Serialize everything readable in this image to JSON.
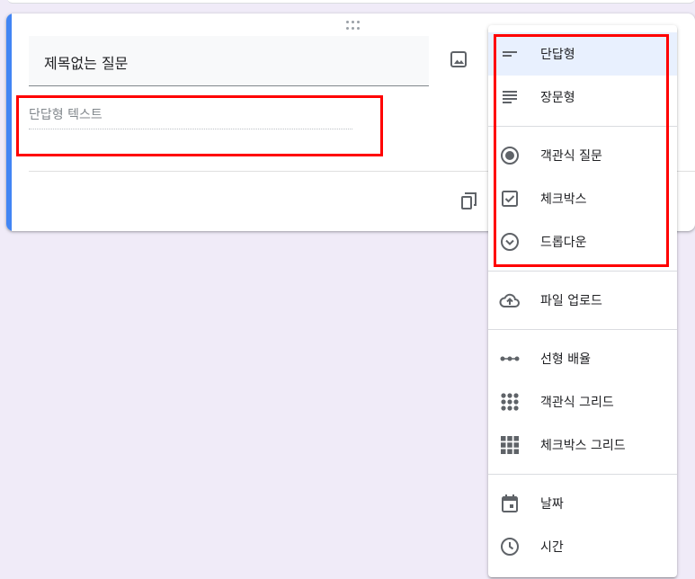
{
  "question": {
    "title": "제목없는 질문",
    "short_answer_placeholder": "단답형 텍스트"
  },
  "menu": {
    "groups": [
      [
        {
          "label": "단답형",
          "icon": "short-answer-icon",
          "selected": true
        },
        {
          "label": "장문형",
          "icon": "paragraph-icon"
        }
      ],
      [
        {
          "label": "객관식 질문",
          "icon": "radio-button-icon"
        },
        {
          "label": "체크박스",
          "icon": "checkbox-icon"
        },
        {
          "label": "드롭다운",
          "icon": "dropdown-icon"
        }
      ],
      [
        {
          "label": "파일 업로드",
          "icon": "cloud-upload-icon"
        }
      ],
      [
        {
          "label": "선형 배율",
          "icon": "linear-scale-icon"
        },
        {
          "label": "객관식 그리드",
          "icon": "radio-grid-icon"
        },
        {
          "label": "체크박스 그리드",
          "icon": "checkbox-grid-icon"
        }
      ],
      [
        {
          "label": "날짜",
          "icon": "calendar-icon"
        },
        {
          "label": "시간",
          "icon": "clock-icon"
        }
      ]
    ]
  },
  "colors": {
    "accent": "#4285f4",
    "selected_bg": "#e8f0fe",
    "highlight": "#ff0000",
    "page_bg": "#f0ebf8"
  }
}
